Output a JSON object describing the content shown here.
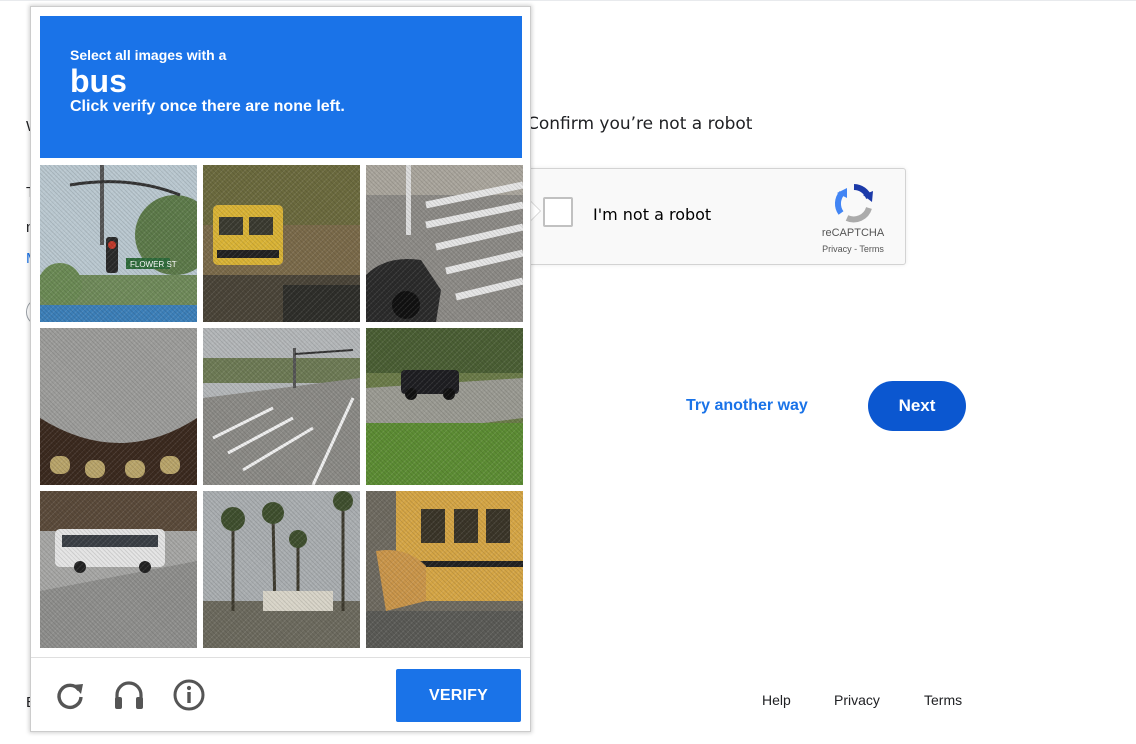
{
  "background": {
    "heading": "Confirm you’re not a robot",
    "recaptcha": {
      "checkbox_label": "I'm not a robot",
      "brand": "reCAPTCHA",
      "links": "Privacy - Terms",
      "logo_icon": "recaptcha-logo-icon"
    },
    "try_another_way": "Try another way",
    "next": "Next",
    "footer": {
      "help": "Help",
      "privacy": "Privacy",
      "terms": "Terms"
    },
    "edge_fragments": [
      "W",
      "T",
      "n",
      "M",
      "E"
    ]
  },
  "challenge": {
    "instruction_pre": "Select all images with a",
    "target": "bus",
    "instruction_post": "Click verify once there are none left.",
    "tiles": [
      {
        "scene": "traffic light and Flower St sign"
      },
      {
        "scene": "yellow school bus front"
      },
      {
        "scene": "crosswalk with car"
      },
      {
        "scene": "road and arched building"
      },
      {
        "scene": "empty road with lane markings"
      },
      {
        "scene": "dark SUV on grass"
      },
      {
        "scene": "city bus on street"
      },
      {
        "scene": "palm trees"
      },
      {
        "scene": "yellow school bus side"
      }
    ],
    "controls": {
      "reload_icon": "reload-icon",
      "audio_icon": "headphones-icon",
      "info_icon": "info-icon"
    },
    "verify": "VERIFY"
  },
  "colors": {
    "banner": "#1a73e8",
    "verify": "#1a73e8",
    "next": "#0b57d0",
    "link": "#1a73e8"
  }
}
